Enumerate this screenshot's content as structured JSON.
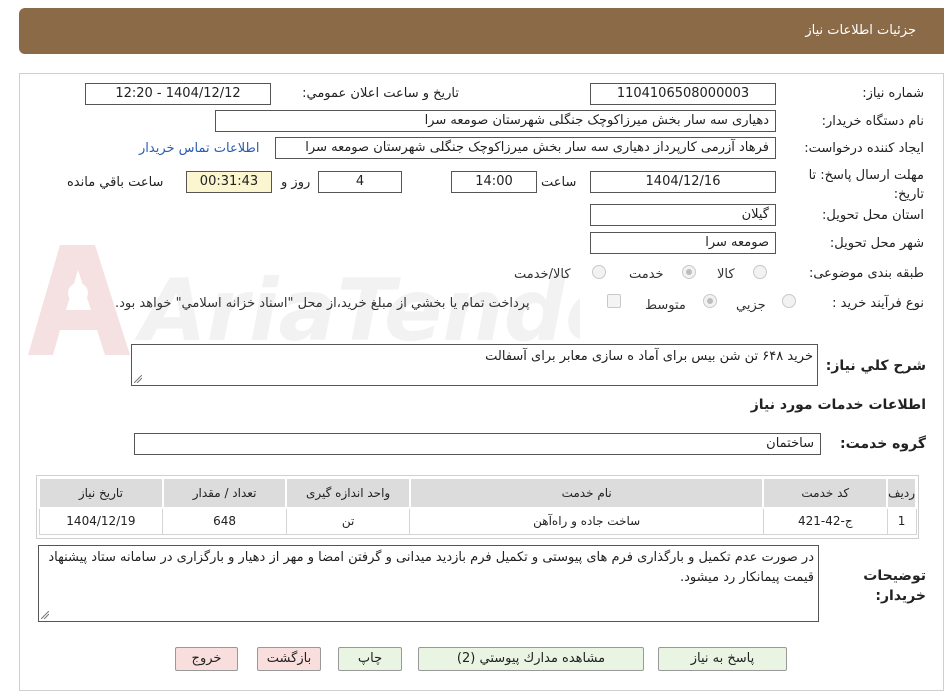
{
  "header": {
    "title": "جزئیات اطلاعات نیاز"
  },
  "form": {
    "need_number_label": "شماره نیاز:",
    "need_number": "1104106508000003",
    "announce_label": "تاریخ و ساعت اعلان عمومي:",
    "announce_value": "1404/12/12 - 12:20",
    "buyer_org_label": "نام دستگاه خريدار:",
    "buyer_org": "دهیاری سه سار بخش میرزاکوچک جنگلی شهرستان صومعه سرا",
    "requester_label": "ايجاد كننده درخواست:",
    "requester": "فرهاد آزرمی کارپرداز دهیاری سه سار بخش میرزاکوچک جنگلی شهرستان صومعه سرا",
    "contact_link": "اطلاعات تماس خريدار",
    "deadline_label": "مهلت ارسال پاسخ: تا تاريخ:",
    "deadline_date": "1404/12/16",
    "time_label": "ساعت",
    "deadline_time": "14:00",
    "days_value": "4",
    "days_label": "روز و",
    "remaining_time": "00:31:43",
    "remaining_label": "ساعت باقي مانده",
    "province_label": "استان محل تحويل:",
    "province": "گيلان",
    "city_label": "شهر محل تحويل:",
    "city": "صومعه سرا",
    "category_label": "طبقه بندی موضوعی:",
    "category_options": [
      "كالا",
      "خدمت",
      "كالا/خدمت"
    ],
    "category_selected": "خدمت",
    "process_label": "نوع فرآيند خريد :",
    "process_options": [
      "جزيي",
      "متوسط"
    ],
    "process_selected": "متوسط",
    "payment_note": "پرداخت تمام يا بخشي از مبلغ خريد،از محل \"اسناد خزانه اسلامي\" خواهد بود.",
    "general_desc_label": "شرح كلي نياز:",
    "general_desc": "خرید ۶۴۸ تن شن بیس برای آماد ه سازی معابر برای آسفالت",
    "services_title": "اطلاعات خدمات مورد نياز",
    "service_group_label": "گروه خدمت:",
    "service_group": "ساختمان",
    "buyer_notes_label": "توضيحات خريدار:",
    "buyer_notes": "در صورت عدم تکمیل و بارگذاری فرم های پیوستی و تکمیل فرم بازدید میدانی و گرفتن امضا و مهر از دهیار و بارگزاری در سامانه ستاد پیشنهاد قیمت پیمانکار رد میشود."
  },
  "table": {
    "headers": [
      "رديف",
      "كد خدمت",
      "نام خدمت",
      "واحد اندازه گيری",
      "تعداد / مقدار",
      "تاريخ نياز"
    ],
    "rows": [
      [
        "1",
        "ج-42-421",
        "ساخت جاده و راه‌آهن",
        "تن",
        "648",
        "1404/12/19"
      ]
    ]
  },
  "buttons": {
    "reply": "پاسخ به نياز",
    "attachments": "مشاهده مدارك پيوستي (2)",
    "print": "چاپ",
    "back": "بازگشت",
    "exit": "خروج"
  },
  "watermark_text": "AriaTender.neT",
  "colors": {
    "header": "#8a6a47",
    "link": "#2a5db0",
    "button_green": "#e9f5e2",
    "button_pink": "#f9dede",
    "remaining_bg": "#fbf5d0"
  }
}
